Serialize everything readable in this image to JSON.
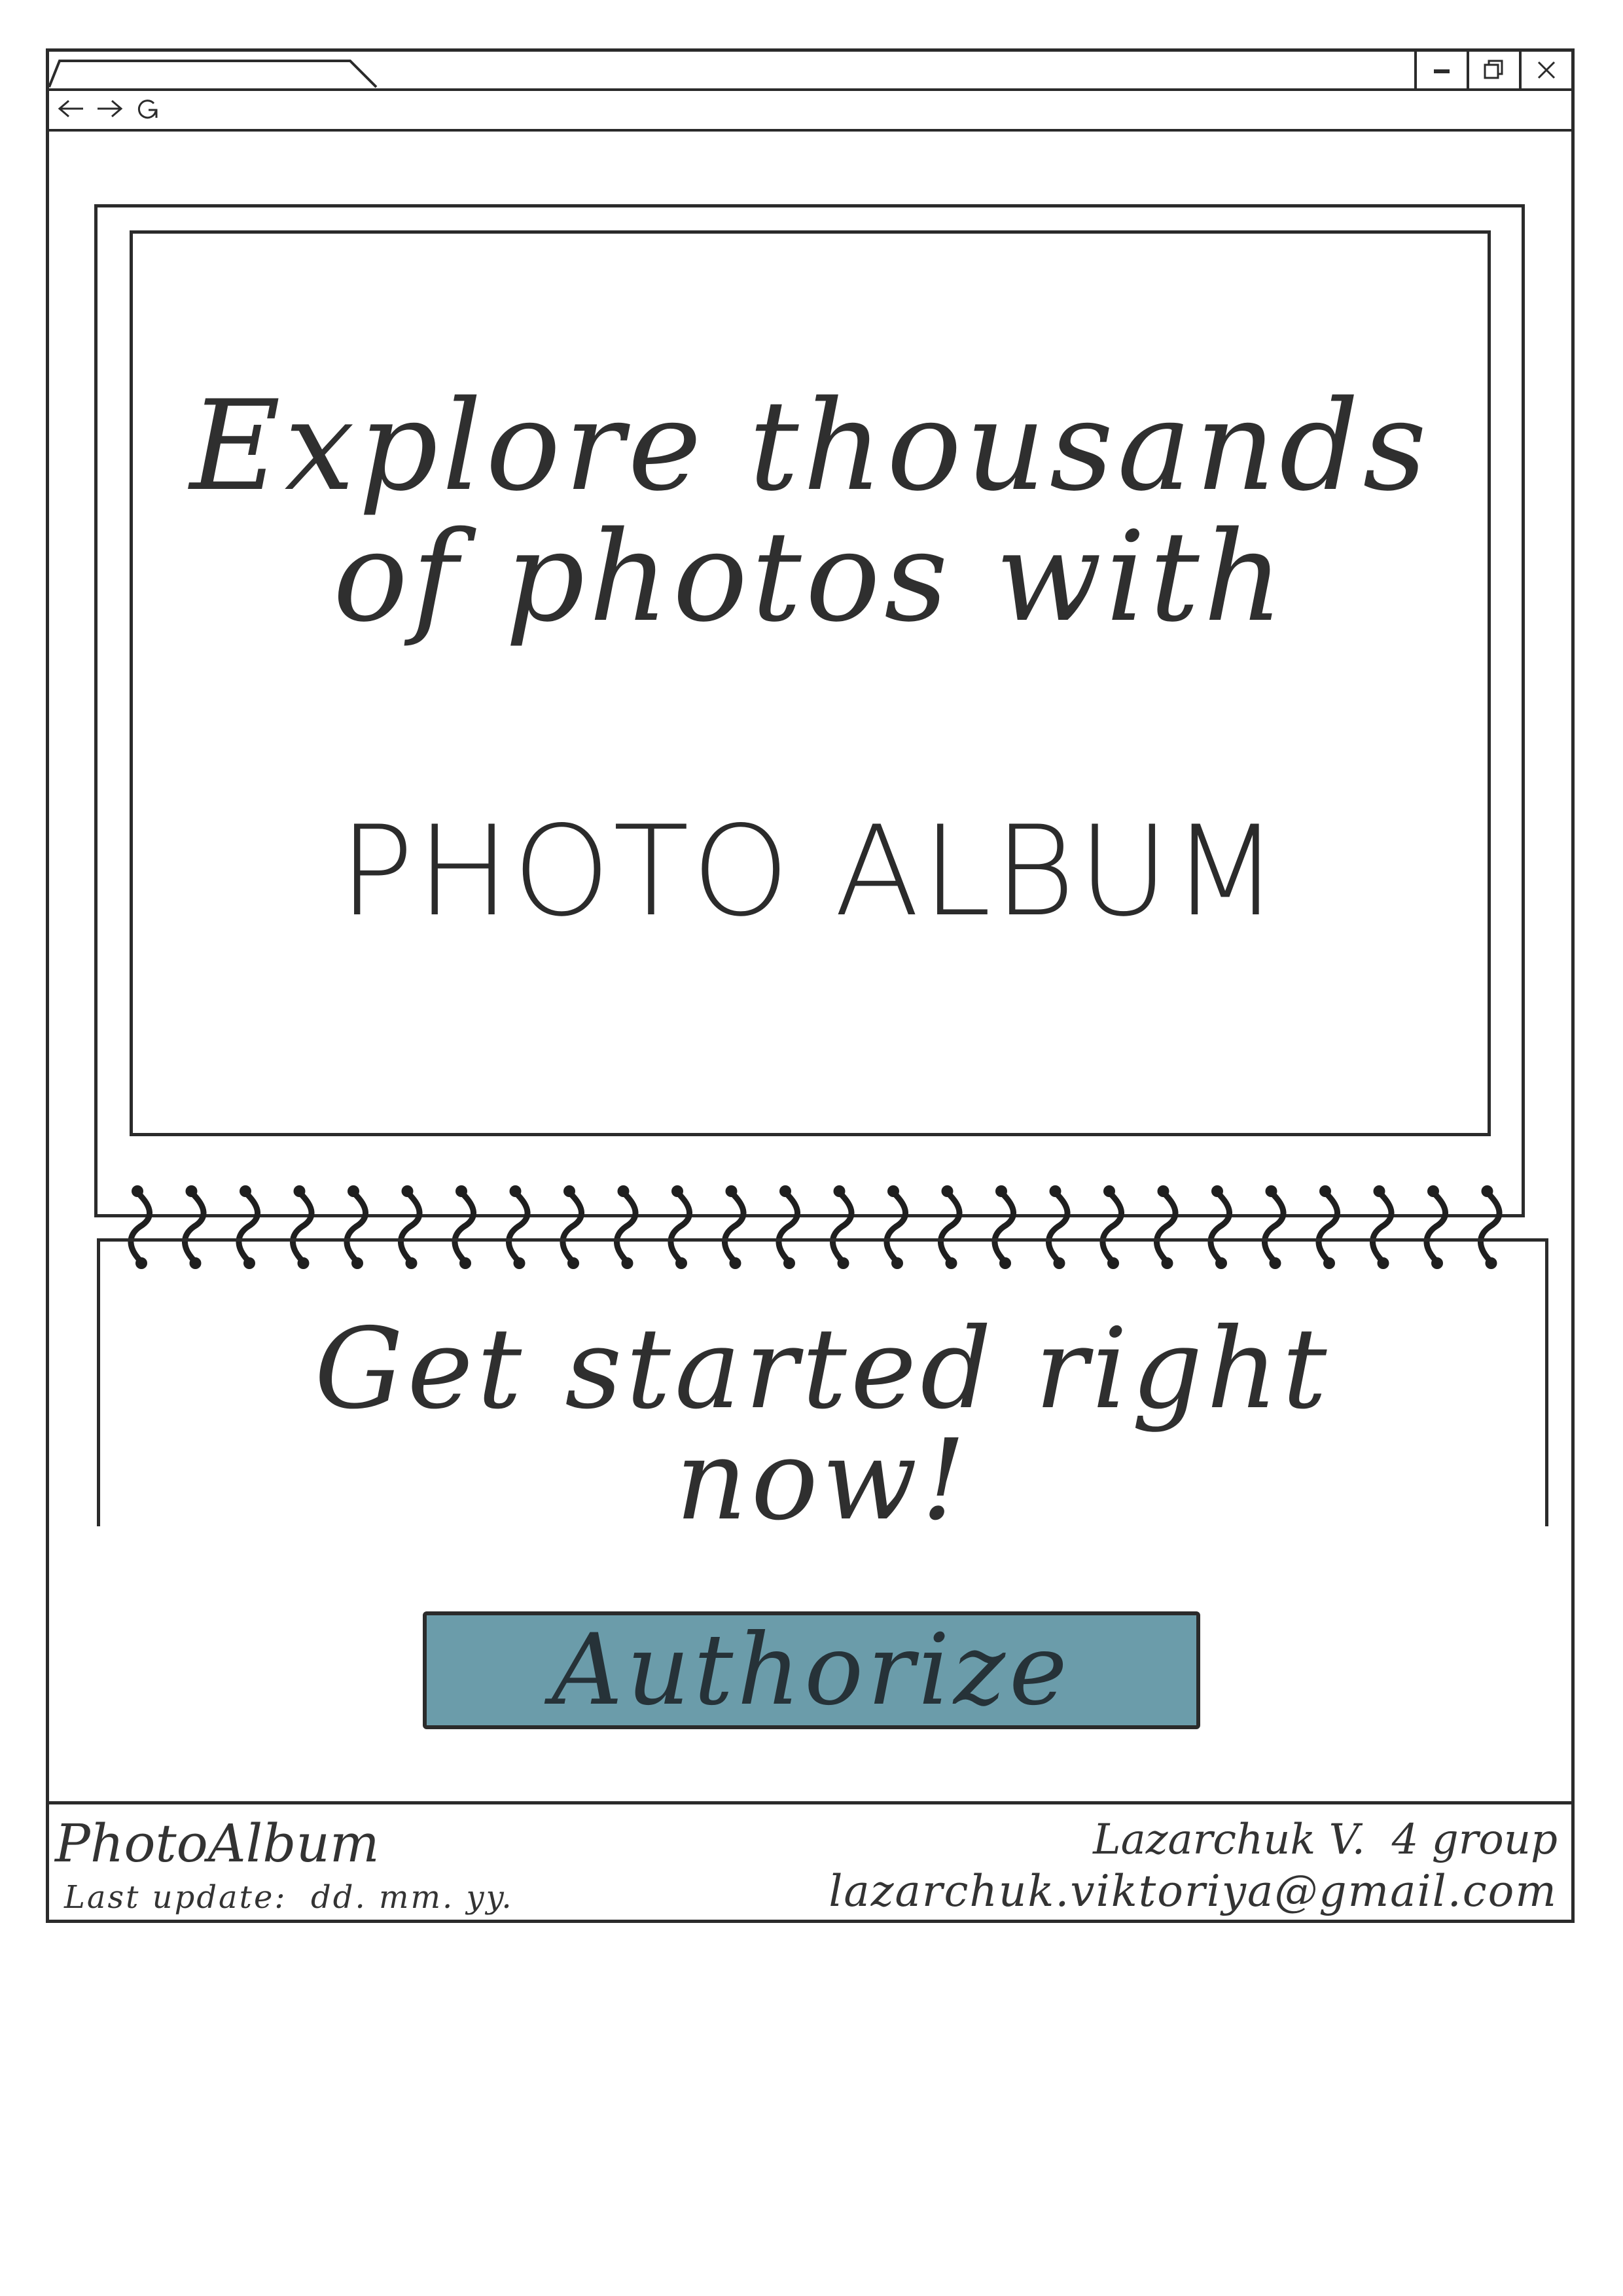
{
  "browser": {
    "controls": [
      "minimize",
      "restore",
      "close"
    ],
    "nav_icons": [
      "back-arrow-icon",
      "forward-arrow-icon",
      "reload-icon"
    ]
  },
  "hero": {
    "line1": "Explore thousands",
    "line2": "of photos with",
    "title": "PHOTO ALBUM"
  },
  "cta": {
    "line1": "Get started right",
    "line2": "now!"
  },
  "authorize_button": {
    "label": "Authorize",
    "color": "#6b9caa"
  },
  "footer": {
    "brand": "PhotoAlbum",
    "last_update": "Last update:  dd. mm. yy.",
    "author": "Lazarchuk V.  4 group",
    "email": "lazarchuk.viktoriya@gmail.com"
  }
}
